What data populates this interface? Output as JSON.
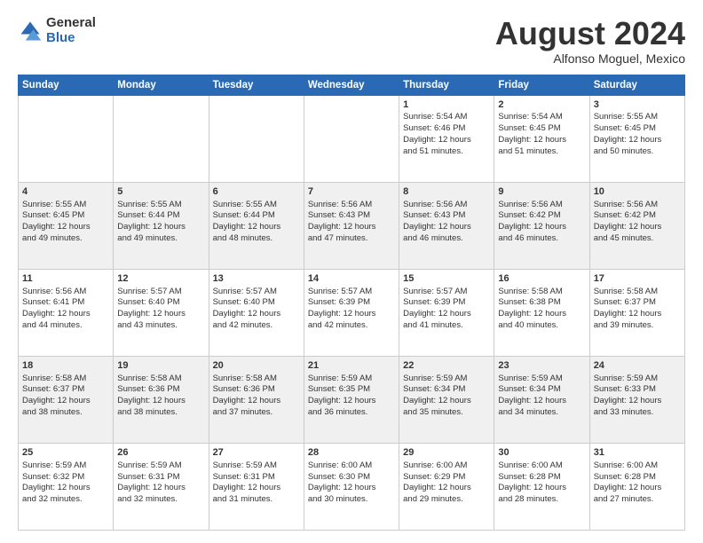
{
  "logo": {
    "general": "General",
    "blue": "Blue"
  },
  "title": "August 2024",
  "location": "Alfonso Moguel, Mexico",
  "days_of_week": [
    "Sunday",
    "Monday",
    "Tuesday",
    "Wednesday",
    "Thursday",
    "Friday",
    "Saturday"
  ],
  "weeks": [
    [
      {
        "day": "",
        "info": ""
      },
      {
        "day": "",
        "info": ""
      },
      {
        "day": "",
        "info": ""
      },
      {
        "day": "",
        "info": ""
      },
      {
        "day": "1",
        "info": "Sunrise: 5:54 AM\nSunset: 6:46 PM\nDaylight: 12 hours\nand 51 minutes."
      },
      {
        "day": "2",
        "info": "Sunrise: 5:54 AM\nSunset: 6:45 PM\nDaylight: 12 hours\nand 51 minutes."
      },
      {
        "day": "3",
        "info": "Sunrise: 5:55 AM\nSunset: 6:45 PM\nDaylight: 12 hours\nand 50 minutes."
      }
    ],
    [
      {
        "day": "4",
        "info": "Sunrise: 5:55 AM\nSunset: 6:45 PM\nDaylight: 12 hours\nand 49 minutes."
      },
      {
        "day": "5",
        "info": "Sunrise: 5:55 AM\nSunset: 6:44 PM\nDaylight: 12 hours\nand 49 minutes."
      },
      {
        "day": "6",
        "info": "Sunrise: 5:55 AM\nSunset: 6:44 PM\nDaylight: 12 hours\nand 48 minutes."
      },
      {
        "day": "7",
        "info": "Sunrise: 5:56 AM\nSunset: 6:43 PM\nDaylight: 12 hours\nand 47 minutes."
      },
      {
        "day": "8",
        "info": "Sunrise: 5:56 AM\nSunset: 6:43 PM\nDaylight: 12 hours\nand 46 minutes."
      },
      {
        "day": "9",
        "info": "Sunrise: 5:56 AM\nSunset: 6:42 PM\nDaylight: 12 hours\nand 46 minutes."
      },
      {
        "day": "10",
        "info": "Sunrise: 5:56 AM\nSunset: 6:42 PM\nDaylight: 12 hours\nand 45 minutes."
      }
    ],
    [
      {
        "day": "11",
        "info": "Sunrise: 5:56 AM\nSunset: 6:41 PM\nDaylight: 12 hours\nand 44 minutes."
      },
      {
        "day": "12",
        "info": "Sunrise: 5:57 AM\nSunset: 6:40 PM\nDaylight: 12 hours\nand 43 minutes."
      },
      {
        "day": "13",
        "info": "Sunrise: 5:57 AM\nSunset: 6:40 PM\nDaylight: 12 hours\nand 42 minutes."
      },
      {
        "day": "14",
        "info": "Sunrise: 5:57 AM\nSunset: 6:39 PM\nDaylight: 12 hours\nand 42 minutes."
      },
      {
        "day": "15",
        "info": "Sunrise: 5:57 AM\nSunset: 6:39 PM\nDaylight: 12 hours\nand 41 minutes."
      },
      {
        "day": "16",
        "info": "Sunrise: 5:58 AM\nSunset: 6:38 PM\nDaylight: 12 hours\nand 40 minutes."
      },
      {
        "day": "17",
        "info": "Sunrise: 5:58 AM\nSunset: 6:37 PM\nDaylight: 12 hours\nand 39 minutes."
      }
    ],
    [
      {
        "day": "18",
        "info": "Sunrise: 5:58 AM\nSunset: 6:37 PM\nDaylight: 12 hours\nand 38 minutes."
      },
      {
        "day": "19",
        "info": "Sunrise: 5:58 AM\nSunset: 6:36 PM\nDaylight: 12 hours\nand 38 minutes."
      },
      {
        "day": "20",
        "info": "Sunrise: 5:58 AM\nSunset: 6:36 PM\nDaylight: 12 hours\nand 37 minutes."
      },
      {
        "day": "21",
        "info": "Sunrise: 5:59 AM\nSunset: 6:35 PM\nDaylight: 12 hours\nand 36 minutes."
      },
      {
        "day": "22",
        "info": "Sunrise: 5:59 AM\nSunset: 6:34 PM\nDaylight: 12 hours\nand 35 minutes."
      },
      {
        "day": "23",
        "info": "Sunrise: 5:59 AM\nSunset: 6:34 PM\nDaylight: 12 hours\nand 34 minutes."
      },
      {
        "day": "24",
        "info": "Sunrise: 5:59 AM\nSunset: 6:33 PM\nDaylight: 12 hours\nand 33 minutes."
      }
    ],
    [
      {
        "day": "25",
        "info": "Sunrise: 5:59 AM\nSunset: 6:32 PM\nDaylight: 12 hours\nand 32 minutes."
      },
      {
        "day": "26",
        "info": "Sunrise: 5:59 AM\nSunset: 6:31 PM\nDaylight: 12 hours\nand 32 minutes."
      },
      {
        "day": "27",
        "info": "Sunrise: 5:59 AM\nSunset: 6:31 PM\nDaylight: 12 hours\nand 31 minutes."
      },
      {
        "day": "28",
        "info": "Sunrise: 6:00 AM\nSunset: 6:30 PM\nDaylight: 12 hours\nand 30 minutes."
      },
      {
        "day": "29",
        "info": "Sunrise: 6:00 AM\nSunset: 6:29 PM\nDaylight: 12 hours\nand 29 minutes."
      },
      {
        "day": "30",
        "info": "Sunrise: 6:00 AM\nSunset: 6:28 PM\nDaylight: 12 hours\nand 28 minutes."
      },
      {
        "day": "31",
        "info": "Sunrise: 6:00 AM\nSunset: 6:28 PM\nDaylight: 12 hours\nand 27 minutes."
      }
    ]
  ]
}
